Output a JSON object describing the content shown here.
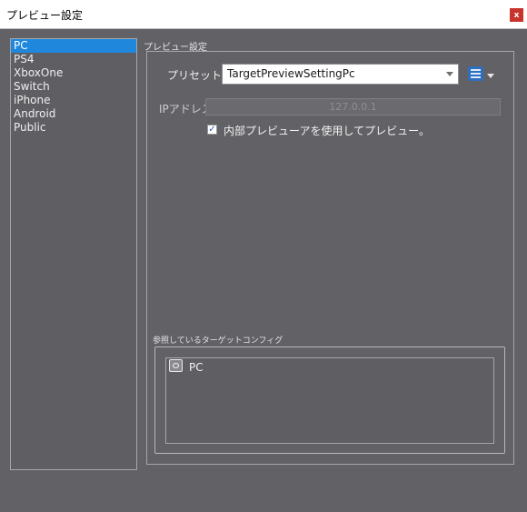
{
  "window": {
    "title": "プレビュー設定",
    "close_label": "x"
  },
  "sidebar": {
    "items": [
      {
        "label": "PC",
        "selected": true
      },
      {
        "label": "PS4"
      },
      {
        "label": "XboxOne"
      },
      {
        "label": "Switch"
      },
      {
        "label": "iPhone"
      },
      {
        "label": "Android"
      },
      {
        "label": "Public"
      }
    ]
  },
  "settings": {
    "section_title": "プレビュー設定",
    "preset": {
      "label": "プリセット",
      "value": "TargetPreviewSettingPc"
    },
    "list_button_icon": "list-icon",
    "ip": {
      "label": "IPアドレス",
      "value": "127.0.0.1",
      "disabled": true
    },
    "internal_preview": {
      "label": "内部プレビューアを使用してプレビュー。",
      "checked": true
    }
  },
  "reference": {
    "title": "参照しているターゲットコンフィグ",
    "items": [
      {
        "icon": "target-config-icon",
        "label": "PC"
      }
    ]
  },
  "colors": {
    "background": "#626166",
    "selection": "#1f88dd",
    "close_button": "#c8342c",
    "checkbox_check": "#1a62c8"
  }
}
